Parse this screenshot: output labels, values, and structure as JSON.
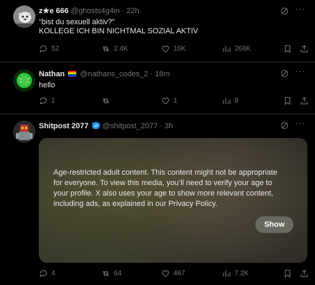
{
  "tweets": [
    {
      "name": "z★e 666",
      "handle": "@ghosts4g4in",
      "sep": "·",
      "time": "22h",
      "lines": [
        "\"bist du sexuell aktiv?\"",
        "KOLLEGE ICH BIN NICHTMAL SOZIAL AKTIV"
      ],
      "replies": "52",
      "reposts": "2.4K",
      "likes": "16K",
      "views": "268K"
    },
    {
      "name": "Nathan",
      "handle": "@nathans_codes_2",
      "sep": "·",
      "time": "18m",
      "text": "hello",
      "replies": "1",
      "reposts": "",
      "likes": "1",
      "views": "8"
    },
    {
      "name": "Shitpost 2077",
      "handle": "@shitpost_2077",
      "sep": "·",
      "time": "3h",
      "media_warning": "Age-restricted adult content. This content might not be appropriate for everyone. To view this media, you’ll need to verify your age to your profile. X also uses your age to show more relevant content, including ads, as explained in our Privacy Policy.",
      "show_label": "Show",
      "replies": "4",
      "reposts": "64",
      "likes": "467",
      "views": "7.2K"
    }
  ],
  "colors": {
    "background": "#000000",
    "text": "#e7e9ea",
    "muted": "#71767b",
    "verified": "#1d9bf0",
    "divider": "#2f3336"
  },
  "icons": {
    "reply": "reply-icon",
    "repost": "repost-icon",
    "like": "heart-icon",
    "views": "views-icon",
    "bookmark": "bookmark-icon",
    "share": "share-icon",
    "grok": "grok-icon",
    "more": "more-icon"
  },
  "more_glyph": "···"
}
